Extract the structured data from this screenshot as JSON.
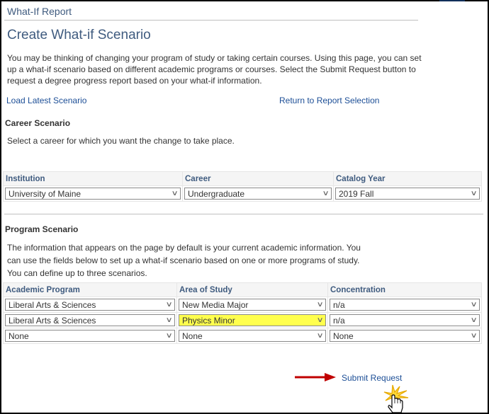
{
  "header": {
    "title": "What-If Report"
  },
  "page": {
    "title": "Create What-if Scenario",
    "intro": "You may be thinking of changing your program of study or taking certain courses. Using this page, you can set up a what-if scenario based on different academic programs or courses. Select the Submit Request button to request a degree progress report based on your what-if information."
  },
  "links": {
    "load_latest": "Load Latest Scenario",
    "return_to_selection": "Return to Report Selection",
    "submit": "Submit Request"
  },
  "career": {
    "title": "Career Scenario",
    "description": "Select a career for which you want the change to take place.",
    "columns": [
      "Institution",
      "Career",
      "Catalog Year"
    ],
    "values": [
      "University of Maine",
      "Undergraduate",
      "2019 Fall"
    ]
  },
  "program": {
    "title": "Program Scenario",
    "description_lines": [
      "The information that appears on the page by default is your current academic information. You",
      "can use the fields below to set up a what-if scenario based on one or more programs of study.",
      "You can define up to three scenarios."
    ],
    "columns": [
      "Academic Program",
      "Area of Study",
      "Concentration"
    ],
    "rows": [
      [
        "Liberal Arts & Sciences",
        "New Media Major",
        "n/a"
      ],
      [
        "Liberal Arts & Sciences",
        "Physics Minor",
        "n/a"
      ],
      [
        "None",
        "None",
        "None"
      ]
    ],
    "highlighted_cell": "Physics Minor"
  },
  "colors": {
    "link": "#1c4e96",
    "heading": "#3f5b7f",
    "highlight": "#ffff4d",
    "arrow": "#c00000"
  },
  "icons": {
    "dropdown": "chevron-down-icon",
    "annotation_arrow": "arrow-right-icon",
    "cursor": "hand-pointer-icon"
  }
}
